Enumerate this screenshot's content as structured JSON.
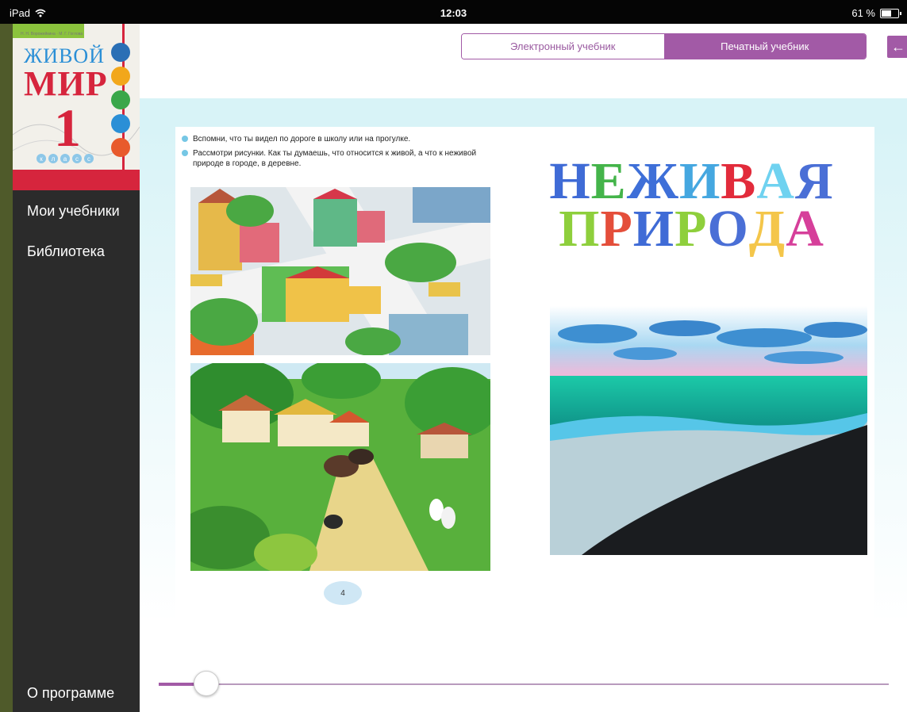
{
  "status_bar": {
    "device": "iPad",
    "time": "12:03",
    "battery": "61 %"
  },
  "cover": {
    "authors": "Н. Н. Ворожейкина · М. Г. Гоглова",
    "title_line1": "ЖИВОЙ",
    "title_line2": "МИР",
    "grade": "1",
    "grade_label": "класс",
    "circle_colors": [
      "#2a6fb5",
      "#f2a71b",
      "#3aa74a",
      "#2b8fd6",
      "#e85a2c"
    ]
  },
  "sidebar": {
    "items": [
      {
        "label": "Мои учебники"
      },
      {
        "label": "Библиотека"
      },
      {
        "label": "О программе"
      }
    ]
  },
  "toggle": {
    "electronic": "Электронный учебник",
    "printed": "Печатный учебник",
    "selected": "printed"
  },
  "back_icon": "arrow-left-icon",
  "page_left": {
    "instructions": [
      "Вспомни, что ты видел по дороге в школу или на прогулке.",
      "Рассмотри рисунки. Как ты думаешь, что относится к живой, а что к неживой природе в городе, в деревне."
    ],
    "page_number": "4"
  },
  "page_right": {
    "title_line1": "НЕЖИВАЯ",
    "title_line2": "ПРИРОДА",
    "letter_colors_line1": [
      "#3f6bd6",
      "#44b44a",
      "#3e6fd8",
      "#45a7e0",
      "#e22b3b",
      "#6fd2f0",
      "#4a6fd6"
    ],
    "letter_colors_line2": [
      "#8ecf3c",
      "#e44e3a",
      "#3f6bd6",
      "#8ecf3c",
      "#4a6fd6",
      "#f4c64a",
      "#d63f9a"
    ]
  },
  "slider": {
    "position": 0.065
  },
  "colors": {
    "accent": "#a25aa6",
    "sidebar": "#2b2b2b"
  }
}
